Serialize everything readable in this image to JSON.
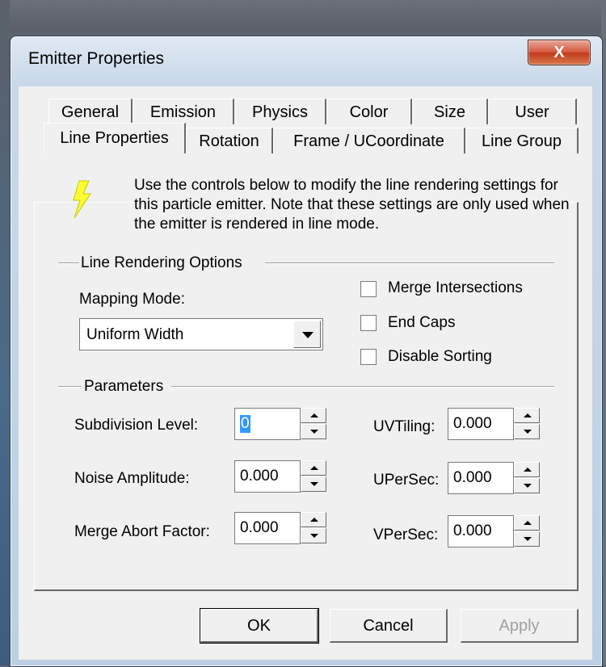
{
  "window": {
    "title": "Emitter Properties",
    "close_label": "X"
  },
  "tabs_row1": [
    "General",
    "Emission",
    "Physics",
    "Color",
    "Size",
    "User"
  ],
  "tabs_row2": [
    "Line Properties",
    "Rotation",
    "Frame / UCoordinate",
    "Line Group"
  ],
  "active_tab": "Line Properties",
  "intro": "Use the controls below to modify the line rendering settings for this particle emitter.  Note that these settings are only used when the emitter is rendered in line mode.",
  "icon": "lightning-bolt-icon",
  "line_rendering": {
    "group_label": "Line Rendering Options",
    "mapping_mode_label": "Mapping Mode:",
    "mapping_mode_value": "Uniform Width",
    "checkboxes": [
      {
        "label": "Merge Intersections",
        "checked": false
      },
      {
        "label": "End Caps",
        "checked": false
      },
      {
        "label": "Disable Sorting",
        "checked": false
      }
    ]
  },
  "parameters": {
    "group_label": "Parameters",
    "subdivision_label": "Subdivision Level:",
    "subdivision_value": "0",
    "noise_label": "Noise Amplitude:",
    "noise_value": "0.000",
    "merge_abort_label": "Merge Abort Factor:",
    "merge_abort_value": "0.000",
    "uvtiling_label": "UVTiling:",
    "uvtiling_value": "0.000",
    "upersec_label": "UPerSec:",
    "upersec_value": "0.000",
    "vpersec_label": "VPerSec:",
    "vpersec_value": "0.000"
  },
  "buttons": {
    "ok": "OK",
    "cancel": "Cancel",
    "apply": "Apply"
  }
}
